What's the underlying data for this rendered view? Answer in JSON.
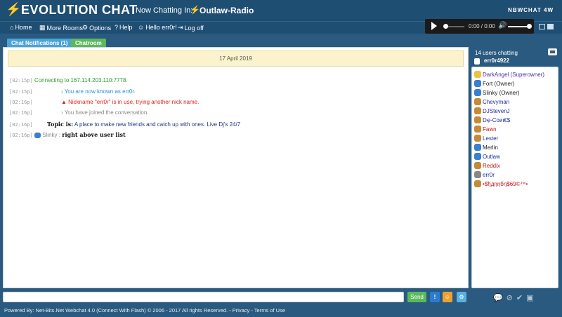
{
  "header": {
    "logo_bolt": "⚡",
    "app_title": "EVOLUTION CHAT",
    "chatting_label": "Now Chatting In:",
    "room_bolt": "⚡",
    "room_name": "Outlaw-Radio",
    "brand": "NBWCHAT 4W"
  },
  "nav": {
    "home": "Home",
    "more_rooms": "More Rooms",
    "options": "Options",
    "help": "Help",
    "hello": "Hello err0r!",
    "logout": "Log off"
  },
  "player": {
    "time": "0:00 / 0:00",
    "progress": 0,
    "volume": 0.9
  },
  "tabs": {
    "notifications": "Chat Notifications (1)",
    "chatroom": "Chatroom"
  },
  "chat": {
    "date": "17 April 2019",
    "messages": [
      {
        "time": "[02:15p]",
        "text": "Connecting to 167.114.203.110:7778."
      },
      {
        "time": "[02:15p]",
        "text": "› You are now known as err0r."
      },
      {
        "time": "[02:16p]",
        "text": "Nickname \"err0r\" is in use, trying another nick name."
      },
      {
        "time": "[02:16p]",
        "text": "› You have joined the conversation."
      },
      {
        "time": "[02:16p]",
        "topic_label": "Topic is:",
        "text": "A place to make new friends and catch up with ones. Live Dj's 24/7"
      },
      {
        "time": "[02:16p]",
        "user": "Slinky",
        "sep": ":",
        "text": "right above user list"
      }
    ]
  },
  "users": {
    "count_label": "14 users chatting",
    "me": "err0r4922",
    "list": [
      {
        "name": "DarkAngel (Superowner)"
      },
      {
        "name": "Fort (Owner)"
      },
      {
        "name": "Slinky (Owner)"
      },
      {
        "name": "Chevyman"
      },
      {
        "name": "DJStevenJ"
      },
      {
        "name": "Dҿ-Ϲoиι€$"
      },
      {
        "name": "Fawn"
      },
      {
        "name": "Lester"
      },
      {
        "name": "Merlin"
      },
      {
        "name": "Outlaw"
      },
      {
        "name": "Reddix"
      },
      {
        "name": "err0r"
      },
      {
        "name": "•$ђдηηбŋ$69©™•"
      }
    ]
  },
  "input": {
    "send_label": "Send",
    "alert_label": "!",
    "smile_label": "☺",
    "gear_label": "⚙"
  },
  "footer": {
    "text": "Powered By: Net-Bits.Net Webchat 4.0 (Connect With Flash) © 2006 - 2017 All rights Reserved. - Privacy - Terms of Use"
  },
  "colors": {
    "header_bg": "#1f4e73",
    "page_bg": "#2a5a80",
    "send_green": "#5cb85c",
    "date_bar": "#fbf3cc"
  }
}
